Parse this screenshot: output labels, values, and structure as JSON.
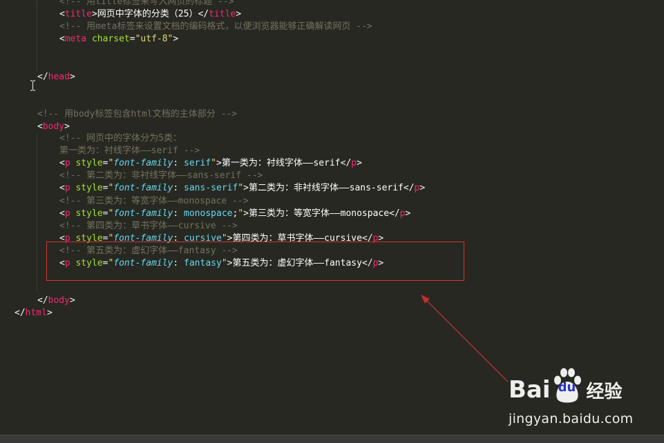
{
  "editor": {
    "lines": [
      {
        "id": "comment-title",
        "parts": [
          {
            "cls": "c",
            "text": "<!-- 用title标签来写入网页的标题 -->"
          }
        ]
      },
      {
        "id": "title-tag",
        "parts": [
          {
            "cls": "p",
            "text": "<"
          },
          {
            "cls": "t",
            "text": "title"
          },
          {
            "cls": "p",
            "text": ">"
          },
          {
            "cls": "x",
            "text": "网页中字体的分类（25）"
          },
          {
            "cls": "p",
            "text": "</"
          },
          {
            "cls": "t",
            "text": "title"
          },
          {
            "cls": "p",
            "text": ">"
          }
        ]
      },
      {
        "id": "comment-meta",
        "parts": [
          {
            "cls": "c",
            "text": "<!-- 用meta标签来设置文档的编码格式，以便浏览器能够正确解读网页 -->"
          }
        ]
      },
      {
        "id": "meta-tag",
        "parts": [
          {
            "cls": "p",
            "text": "<"
          },
          {
            "cls": "t",
            "text": "meta"
          },
          {
            "cls": "p",
            "text": " "
          },
          {
            "cls": "a",
            "text": "charset"
          },
          {
            "cls": "p",
            "text": "="
          },
          {
            "cls": "s",
            "text": "\"utf-8\""
          },
          {
            "cls": "p",
            "text": ">"
          }
        ]
      },
      {
        "id": "head-close",
        "parts": [
          {
            "cls": "p",
            "text": "</"
          },
          {
            "cls": "t",
            "text": "head"
          },
          {
            "cls": "p",
            "text": ">"
          }
        ]
      },
      {
        "id": "comment-body",
        "parts": [
          {
            "cls": "c",
            "text": "<!-- 用body标签包含html文档的主体部分 -->"
          }
        ]
      },
      {
        "id": "body-open",
        "parts": [
          {
            "cls": "p",
            "text": "<"
          },
          {
            "cls": "t",
            "text": "body"
          },
          {
            "cls": "p",
            "text": ">"
          }
        ]
      },
      {
        "id": "comment-fonts-intro",
        "parts": [
          {
            "cls": "c",
            "text": "<!-- 网页中的字体分为5类："
          }
        ]
      },
      {
        "id": "comment-serif",
        "parts": [
          {
            "cls": "c",
            "text": "第一类为：衬线字体——serif -->"
          }
        ]
      },
      {
        "id": "p-serif",
        "parts": [
          {
            "cls": "p",
            "text": "<"
          },
          {
            "cls": "t",
            "text": "p"
          },
          {
            "cls": "p",
            "text": " "
          },
          {
            "cls": "a",
            "text": "style"
          },
          {
            "cls": "p",
            "text": "="
          },
          {
            "cls": "s",
            "text": "\""
          },
          {
            "cls": "k",
            "text": "font-family"
          },
          {
            "cls": "p",
            "text": ": "
          },
          {
            "cls": "v",
            "text": "serif"
          },
          {
            "cls": "s",
            "text": "\""
          },
          {
            "cls": "p",
            "text": ">"
          },
          {
            "cls": "x",
            "text": "第一类为：衬线字体——serif"
          },
          {
            "cls": "p",
            "text": "</"
          },
          {
            "cls": "t",
            "text": "p"
          },
          {
            "cls": "p",
            "text": ">"
          }
        ]
      },
      {
        "id": "comment-sans-serif",
        "parts": [
          {
            "cls": "c",
            "text": "<!-- 第二类为：非衬线字体——sans-serif -->"
          }
        ]
      },
      {
        "id": "p-sans-serif",
        "parts": [
          {
            "cls": "p",
            "text": "<"
          },
          {
            "cls": "t",
            "text": "p"
          },
          {
            "cls": "p",
            "text": " "
          },
          {
            "cls": "a",
            "text": "style"
          },
          {
            "cls": "p",
            "text": "="
          },
          {
            "cls": "s",
            "text": "\""
          },
          {
            "cls": "k",
            "text": "font-family"
          },
          {
            "cls": "p",
            "text": ": "
          },
          {
            "cls": "v",
            "text": "sans-serif"
          },
          {
            "cls": "s",
            "text": "\""
          },
          {
            "cls": "p",
            "text": ">"
          },
          {
            "cls": "x",
            "text": "第二类为：非衬线字体——sans-serif"
          },
          {
            "cls": "p",
            "text": "</"
          },
          {
            "cls": "t",
            "text": "p"
          },
          {
            "cls": "p",
            "text": ">"
          }
        ]
      },
      {
        "id": "comment-monospace",
        "parts": [
          {
            "cls": "c",
            "text": "<!-- 第三类为：等宽字体——monospace -->"
          }
        ]
      },
      {
        "id": "p-monospace",
        "parts": [
          {
            "cls": "p",
            "text": "<"
          },
          {
            "cls": "t",
            "text": "p"
          },
          {
            "cls": "p",
            "text": " "
          },
          {
            "cls": "a",
            "text": "style"
          },
          {
            "cls": "p",
            "text": "="
          },
          {
            "cls": "s",
            "text": "\""
          },
          {
            "cls": "k",
            "text": "font-family"
          },
          {
            "cls": "p",
            "text": ": "
          },
          {
            "cls": "v",
            "text": "monospace"
          },
          {
            "cls": "p",
            "text": ";"
          },
          {
            "cls": "s",
            "text": "\""
          },
          {
            "cls": "p",
            "text": ">"
          },
          {
            "cls": "x",
            "text": "第三类为：等宽字体——monospace"
          },
          {
            "cls": "p",
            "text": "</"
          },
          {
            "cls": "t",
            "text": "p"
          },
          {
            "cls": "p",
            "text": ">"
          }
        ]
      },
      {
        "id": "comment-cursive",
        "parts": [
          {
            "cls": "c",
            "text": "<!-- 第四类为：草书字体——cursive -->"
          }
        ]
      },
      {
        "id": "p-cursive",
        "parts": [
          {
            "cls": "p",
            "text": "<"
          },
          {
            "cls": "t",
            "text": "p"
          },
          {
            "cls": "p",
            "text": " "
          },
          {
            "cls": "a",
            "text": "style"
          },
          {
            "cls": "p",
            "text": "="
          },
          {
            "cls": "s",
            "text": "\""
          },
          {
            "cls": "k",
            "text": "font-family"
          },
          {
            "cls": "p",
            "text": ": "
          },
          {
            "cls": "v",
            "text": "cursive"
          },
          {
            "cls": "s",
            "text": "\""
          },
          {
            "cls": "p",
            "text": ">"
          },
          {
            "cls": "x",
            "text": "第四类为：草书字体——cursive"
          },
          {
            "cls": "p",
            "text": "</"
          },
          {
            "cls": "t",
            "text": "p"
          },
          {
            "cls": "p",
            "text": ">"
          }
        ]
      },
      {
        "id": "comment-fantasy",
        "parts": [
          {
            "cls": "c",
            "text": "<!-- 第五类为：虚幻字体——fantasy -->"
          }
        ]
      },
      {
        "id": "p-fantasy",
        "parts": [
          {
            "cls": "p",
            "text": "<"
          },
          {
            "cls": "t",
            "text": "p"
          },
          {
            "cls": "p",
            "text": " "
          },
          {
            "cls": "a",
            "text": "style"
          },
          {
            "cls": "p",
            "text": "="
          },
          {
            "cls": "s",
            "text": "\""
          },
          {
            "cls": "k",
            "text": "font-family"
          },
          {
            "cls": "p",
            "text": ": "
          },
          {
            "cls": "v",
            "text": "fantasy"
          },
          {
            "cls": "s",
            "text": "\""
          },
          {
            "cls": "p",
            "text": ">"
          },
          {
            "cls": "x",
            "text": "第五类为：虚幻字体——fantasy"
          },
          {
            "cls": "p",
            "text": "</"
          },
          {
            "cls": "t",
            "text": "p"
          },
          {
            "cls": "p",
            "text": ">"
          }
        ]
      },
      {
        "id": "body-close",
        "parts": [
          {
            "cls": "p",
            "text": "</"
          },
          {
            "cls": "t",
            "text": "body"
          },
          {
            "cls": "p",
            "text": ">"
          }
        ]
      },
      {
        "id": "html-close",
        "parts": [
          {
            "cls": "p",
            "text": "</"
          },
          {
            "cls": "t",
            "text": "html"
          },
          {
            "cls": "p",
            "text": ">"
          }
        ]
      }
    ]
  },
  "watermark": {
    "brand_left": "Bai",
    "brand_du": "du",
    "brand_right": "经验",
    "url": "jingyan.baidu.com"
  },
  "colors": {
    "background": "#272822",
    "highlight_box": "#d9312b",
    "arrow": "#c0302a"
  }
}
